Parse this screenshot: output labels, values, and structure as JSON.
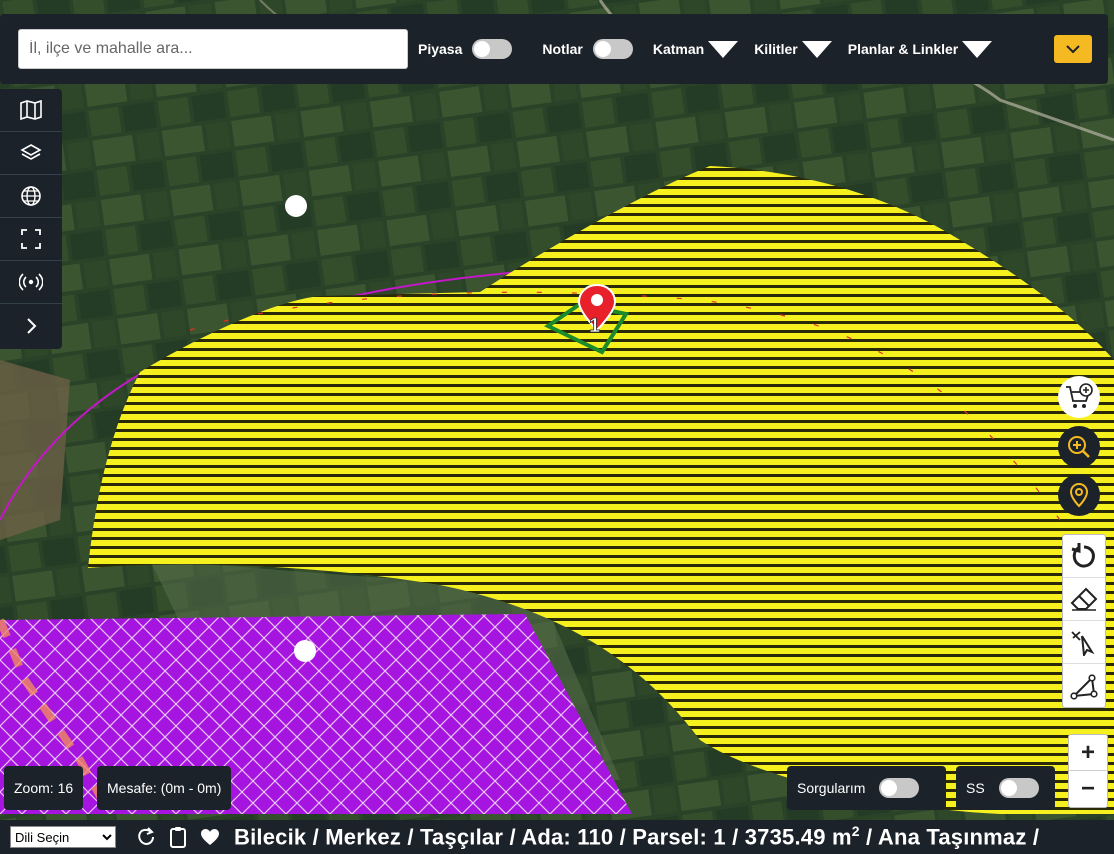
{
  "topbar": {
    "search_placeholder": "İl, ilçe ve mahalle ara...",
    "toggles": [
      {
        "label": "Piyasa"
      },
      {
        "label": "Notlar"
      }
    ],
    "dropdowns": [
      {
        "label": "Katman"
      },
      {
        "label": "Kilitler"
      },
      {
        "label": "Planlar & Linkler"
      }
    ],
    "accent_color": "#f5b921"
  },
  "sidebar": {
    "items": [
      {
        "icon": "map-icon"
      },
      {
        "icon": "layers-icon"
      },
      {
        "icon": "globe-icon"
      },
      {
        "icon": "fullscreen-icon"
      },
      {
        "icon": "broadcast-icon"
      },
      {
        "icon": "chevron-right-icon"
      }
    ]
  },
  "map": {
    "marker_label": "1"
  },
  "right_tools": {
    "zoom_in": "+",
    "zoom_out": "−"
  },
  "bottom": {
    "zoom": "Zoom: 16",
    "distance": "Mesafe: (0m - 0m)",
    "queries": "Sorgularım",
    "ss": "SS"
  },
  "statusbar": {
    "language_default": "Dili Seçin",
    "parcel_text": "Bilecik / Merkez / Taşçılar / Ada: 110 / Parsel: 1 / 3735.49 m",
    "area_exp": "2",
    "parcel_suffix": " / Ana Taşınmaz /"
  }
}
